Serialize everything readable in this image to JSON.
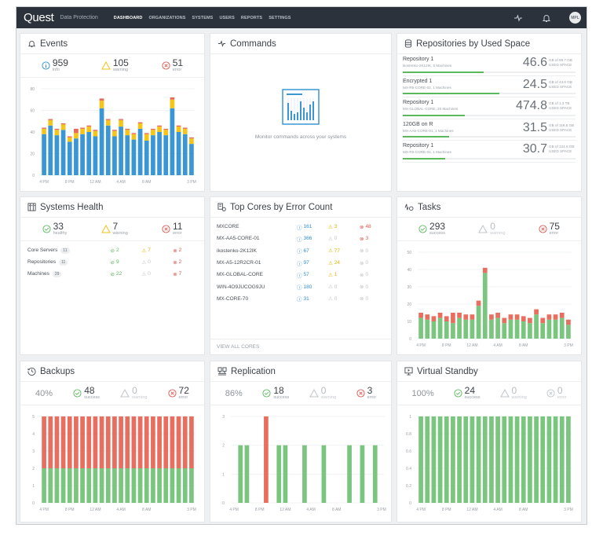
{
  "topbar": {
    "logo": "Quest",
    "product": "Data Protection",
    "nav": [
      "DASHBOARD",
      "ORGANIZATIONS",
      "SYSTEMS",
      "USERS",
      "REPORTS",
      "SETTINGS"
    ],
    "active_nav": "DASHBOARD",
    "avatar_initials": "MPL",
    "icons": [
      "commands-icon",
      "bell-icon",
      "avatar"
    ]
  },
  "colors": {
    "info": "#2f8fd5",
    "warning": "#f0c419",
    "error": "#e86f5f",
    "success": "#7bc67e",
    "topbar": "#2b323b"
  },
  "events": {
    "title": "Events",
    "info": {
      "value": "959",
      "label": "info"
    },
    "warning": {
      "value": "105",
      "label": "warning"
    },
    "error": {
      "value": "51",
      "label": "error"
    }
  },
  "commands": {
    "title": "Commands",
    "empty_text": "Monitor commands across your systems"
  },
  "repositories": {
    "title": "Repositories by Used Space",
    "unit_label": "USED SPACE",
    "items": [
      {
        "name": "Repository 1",
        "sub": "ikostenko-2K12IK, 5 Machines",
        "value": "46.6",
        "of": "GB of 99.7 GB",
        "fill": 0.467
      },
      {
        "name": "Encrypted 1",
        "sub": "MX-R5-CORE-02, 1 Machines",
        "value": "24.5",
        "of": "GB of 43.8 GB",
        "fill": 0.56
      },
      {
        "name": "Repository 1",
        "sub": "MX-GLOBAL-CORE, 20 Machines",
        "value": "474.8",
        "of": "GB of 1.3 TB",
        "fill": 0.36
      },
      {
        "name": "120GB on R",
        "sub": "MX-AA5-CORE-01, 1 Machines",
        "value": "31.5",
        "of": "GB of 118.6 GB",
        "fill": 0.266
      },
      {
        "name": "Repository 1",
        "sub": "MX-R5-CORE-04, 1 Machines",
        "value": "30.7",
        "of": "GB of 124.6 GB",
        "fill": 0.246
      }
    ]
  },
  "systems_health": {
    "title": "Systems Health",
    "healthy": {
      "value": "33",
      "label": "healthy"
    },
    "warning": {
      "value": "7",
      "label": "warning"
    },
    "error": {
      "value": "11",
      "label": "error"
    },
    "rows": [
      {
        "name": "Core Servers",
        "count": "11",
        "ok": "2",
        "warn": "7",
        "err": "2"
      },
      {
        "name": "Repositories",
        "count": "11",
        "ok": "9",
        "warn": "0",
        "err": "2"
      },
      {
        "name": "Machines",
        "count": "29",
        "ok": "22",
        "warn": "0",
        "err": "7"
      }
    ]
  },
  "top_cores": {
    "title": "Top Cores by Error Count",
    "view_all": "VIEW ALL CORES",
    "rows": [
      {
        "name": "MXCORE",
        "info": "161",
        "warn": "3",
        "err": "48"
      },
      {
        "name": "MX-AA5-CORE-01",
        "info": "366",
        "warn": "0",
        "err": "3"
      },
      {
        "name": "ikostenko-2K12IK",
        "info": "67",
        "warn": "77",
        "err": "0"
      },
      {
        "name": "MX-A5-12R2CR-01",
        "info": "97",
        "warn": "24",
        "err": "0"
      },
      {
        "name": "MX-GLOBAL-CORE",
        "info": "57",
        "warn": "1",
        "err": "0"
      },
      {
        "name": "WIN-4O9JUCOG9JU",
        "info": "180",
        "warn": "0",
        "err": "0"
      },
      {
        "name": "MX-CORE-70",
        "info": "31",
        "warn": "0",
        "err": "0"
      }
    ]
  },
  "tasks": {
    "title": "Tasks",
    "success": {
      "value": "293",
      "label": "success"
    },
    "warning": {
      "value": "0",
      "label": "warning"
    },
    "error": {
      "value": "75",
      "label": "error"
    }
  },
  "backups": {
    "title": "Backups",
    "percent": "40%",
    "success": {
      "value": "48",
      "label": "success"
    },
    "warning": {
      "value": "0",
      "label": "warning"
    },
    "error": {
      "value": "72",
      "label": "error"
    }
  },
  "replication": {
    "title": "Replication",
    "percent": "86%",
    "success": {
      "value": "18",
      "label": "success"
    },
    "warning": {
      "value": "0",
      "label": "warning"
    },
    "error": {
      "value": "3",
      "label": "error"
    }
  },
  "virtual_standby": {
    "title": "Virtual Standby",
    "percent": "100%",
    "success": {
      "value": "24",
      "label": "success"
    },
    "warning": {
      "value": "0",
      "label": "warning"
    },
    "error": {
      "value": "0",
      "label": "error"
    }
  },
  "chart_data": [
    {
      "id": "events",
      "type": "bar",
      "stacked": true,
      "title": "Events",
      "xticks": [
        "4 PM",
        "8 PM",
        "12 AM",
        "4 AM",
        "8 AM",
        "3 PM"
      ],
      "xtick_index": [
        0,
        4,
        8,
        12,
        16,
        23
      ],
      "ylim": [
        0,
        80
      ],
      "yticks": [
        0,
        20,
        40,
        60,
        80
      ],
      "series": [
        {
          "name": "info",
          "color": "#3a97d4",
          "values": [
            38,
            46,
            37,
            42,
            31,
            34,
            38,
            40,
            36,
            62,
            46,
            36,
            45,
            37,
            33,
            43,
            32,
            37,
            40,
            37,
            62,
            40,
            38,
            29
          ]
        },
        {
          "name": "warning",
          "color": "#f5c518",
          "values": [
            5,
            5,
            5,
            5,
            4,
            5,
            5,
            5,
            5,
            7,
            5,
            5,
            6,
            5,
            5,
            5,
            6,
            5,
            5,
            5,
            8,
            5,
            5,
            5
          ]
        },
        {
          "name": "error",
          "color": "#e8685a",
          "values": [
            1,
            1,
            1,
            1,
            1,
            4,
            1,
            1,
            1,
            2,
            1,
            1,
            1,
            1,
            1,
            1,
            1,
            1,
            1,
            1,
            2,
            1,
            1,
            1
          ]
        }
      ]
    },
    {
      "id": "tasks",
      "type": "bar",
      "stacked": true,
      "title": "Tasks",
      "xticks": [
        "4 PM",
        "8 PM",
        "12 AM",
        "4 AM",
        "8 AM",
        "3 PM"
      ],
      "xtick_index": [
        0,
        4,
        8,
        12,
        16,
        23
      ],
      "ylim": [
        0,
        50
      ],
      "yticks": [
        0,
        10,
        20,
        30,
        40,
        50
      ],
      "series": [
        {
          "name": "success",
          "color": "#7bc67e",
          "values": [
            12,
            11,
            10,
            12,
            10,
            9,
            12,
            11,
            11,
            19,
            38,
            11,
            12,
            9,
            11,
            11,
            10,
            9,
            14,
            9,
            11,
            11,
            12,
            8
          ]
        },
        {
          "name": "error",
          "color": "#e86f5f",
          "values": [
            3,
            3,
            3,
            3,
            3,
            6,
            3,
            3,
            3,
            3,
            3,
            3,
            3,
            3,
            3,
            3,
            3,
            3,
            3,
            3,
            3,
            3,
            3,
            3
          ]
        }
      ]
    },
    {
      "id": "backups",
      "type": "bar",
      "stacked": true,
      "title": "Backups",
      "xticks": [
        "4 PM",
        "8 PM",
        "12 AM",
        "4 AM",
        "8 AM",
        "3 PM"
      ],
      "xtick_index": [
        0,
        4,
        8,
        12,
        16,
        23
      ],
      "ylim": [
        0,
        5
      ],
      "yticks": [
        0,
        1,
        2,
        3,
        4,
        5
      ],
      "series": [
        {
          "name": "success",
          "color": "#7bc67e",
          "values": [
            2,
            2,
            2,
            2,
            2,
            2,
            2,
            2,
            2,
            2,
            2,
            2,
            2,
            2,
            2,
            2,
            2,
            2,
            2,
            2,
            2,
            2,
            2,
            2
          ]
        },
        {
          "name": "error",
          "color": "#e86f5f",
          "values": [
            3,
            3,
            3,
            3,
            3,
            3,
            3,
            3,
            3,
            3,
            3,
            3,
            3,
            3,
            3,
            3,
            3,
            3,
            3,
            3,
            3,
            3,
            3,
            3
          ]
        }
      ]
    },
    {
      "id": "replication",
      "type": "bar",
      "stacked": true,
      "title": "Replication",
      "xticks": [
        "4 PM",
        "8 PM",
        "12 AM",
        "4 AM",
        "8 AM",
        "3 PM"
      ],
      "xtick_index": [
        0,
        4,
        8,
        12,
        16,
        23
      ],
      "ylim": [
        0,
        3
      ],
      "yticks": [
        0,
        1,
        2,
        3
      ],
      "series": [
        {
          "name": "success",
          "color": "#7bc67e",
          "values": [
            0,
            2,
            2,
            0,
            0,
            0,
            0,
            2,
            2,
            0,
            0,
            2,
            0,
            0,
            2,
            0,
            0,
            0,
            2,
            0,
            2,
            0,
            2,
            0
          ]
        },
        {
          "name": "error",
          "color": "#e86f5f",
          "values": [
            0,
            0,
            0,
            0,
            0,
            3,
            0,
            0,
            0,
            0,
            0,
            0,
            0,
            0,
            0,
            0,
            0,
            0,
            0,
            0,
            0,
            0,
            0,
            0
          ]
        }
      ]
    },
    {
      "id": "virtual_standby",
      "type": "bar",
      "stacked": true,
      "title": "Virtual Standby",
      "xticks": [
        "4 PM",
        "8 PM",
        "12 AM",
        "4 AM",
        "8 AM",
        "3 PM"
      ],
      "xtick_index": [
        0,
        4,
        8,
        12,
        16,
        23
      ],
      "ylim": [
        0,
        1
      ],
      "yticks": [
        "0",
        "0.2",
        "0.4",
        "0.6",
        "0.8",
        "1"
      ],
      "series": [
        {
          "name": "success",
          "color": "#7bc67e",
          "values": [
            1,
            1,
            1,
            1,
            1,
            1,
            1,
            1,
            1,
            1,
            1,
            1,
            1,
            1,
            1,
            1,
            1,
            1,
            1,
            1,
            1,
            1,
            1,
            1
          ]
        }
      ]
    }
  ]
}
